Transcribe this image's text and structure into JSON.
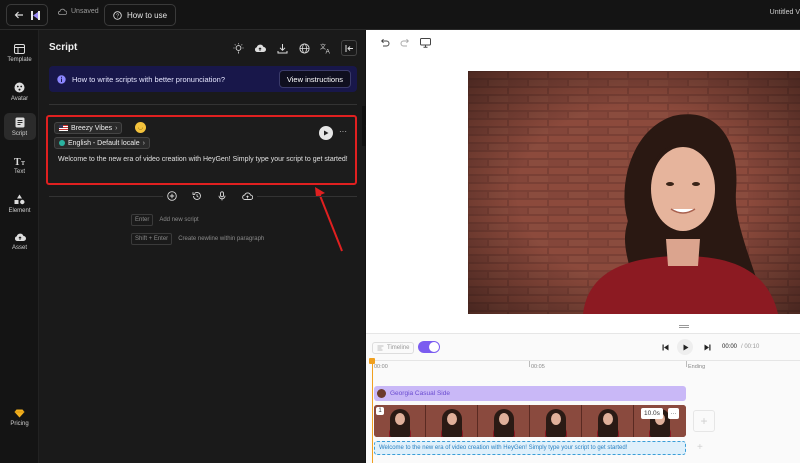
{
  "topbar": {
    "unsaved": "Unsaved",
    "how_to_use": "How to use",
    "title": "Untitled V"
  },
  "nav": {
    "items": [
      {
        "label": "Template",
        "icon": "template-icon"
      },
      {
        "label": "Avatar",
        "icon": "avatar-icon"
      },
      {
        "label": "Script",
        "icon": "script-icon",
        "active": true
      },
      {
        "label": "Text",
        "icon": "text-icon"
      },
      {
        "label": "Element",
        "icon": "element-icon"
      },
      {
        "label": "Asset",
        "icon": "asset-icon"
      }
    ],
    "pricing": "Pricing"
  },
  "script_panel": {
    "title": "Script",
    "banner_text": "How to write scripts with better pronunciation?",
    "banner_button": "View instructions",
    "voice_chip": "Breezy Vibes",
    "locale_chip": "English - Default locale",
    "script_text": "Welcome to the new era of video creation with HeyGen! Simply type your script to get started!",
    "more": "···",
    "hint_enter_key": "Enter",
    "hint_enter_text": "Add new script",
    "hint_shift_key": "Shift + Enter",
    "hint_shift_text": "Create newline within paragraph"
  },
  "timeline": {
    "timeline_label": "Timeline",
    "time_current": "00:00",
    "time_total": "/ 00:10",
    "ruler": [
      "00:00",
      "00:05",
      "Ending"
    ],
    "avatar_track": "Georgia Casual Side",
    "clip_number": "1",
    "duration": "10.0s",
    "clip_more": "···",
    "script_track": "Welcome to the new era of video creation with HeyGen! Simply type your script to get started!"
  },
  "colors": {
    "accent": "#7b5cf0",
    "highlight_border": "#e02020",
    "banner_bg": "#18174a"
  }
}
